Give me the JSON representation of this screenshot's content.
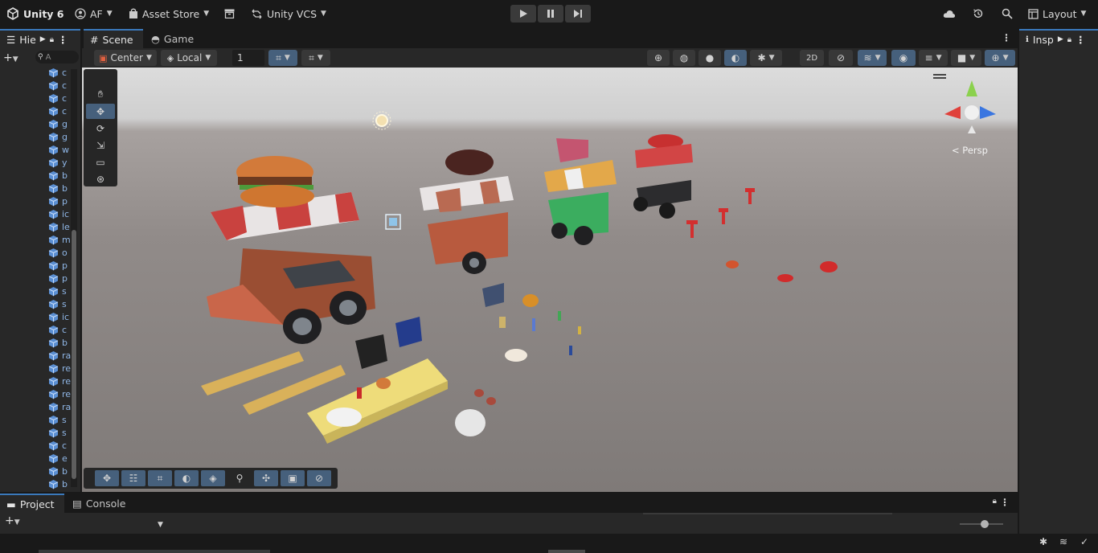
{
  "topbar": {
    "product": "Unity 6",
    "account": "AF",
    "asset_store": "Asset Store",
    "vcs": "Unity VCS",
    "layout": "Layout"
  },
  "hierarchy": {
    "tab_label": "Hie",
    "search_placeholder": "A",
    "items": [
      "c",
      "c",
      "c",
      "c",
      "g",
      "g",
      "w",
      "y",
      "b",
      "b",
      "p",
      "ic",
      "le",
      "m",
      "o",
      "p",
      "p",
      "s",
      "s",
      "ic",
      "c",
      "b",
      "ra",
      "re",
      "re",
      "re",
      "ra",
      "s",
      "s",
      "c",
      "e",
      "b",
      "b"
    ]
  },
  "scene": {
    "tabs": [
      "Scene",
      "Game"
    ],
    "pivot": "Center",
    "space": "Local",
    "snap_value": "1",
    "persp_label": "< Persp"
  },
  "inspector": {
    "tab_label": "Insp"
  },
  "bottom": {
    "tabs": [
      "Project",
      "Console"
    ]
  },
  "colors": {
    "accent": "#46607c",
    "panel": "#282828",
    "background": "#191919"
  }
}
